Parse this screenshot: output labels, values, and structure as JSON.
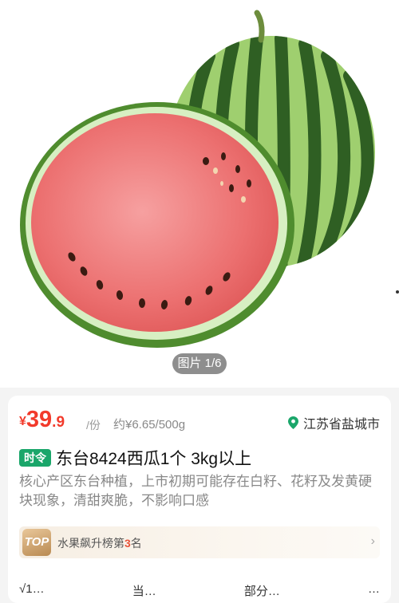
{
  "gallery": {
    "image_alt": "watermelon",
    "counter": "图片 1/6"
  },
  "product": {
    "price": {
      "currency": "¥",
      "integer": "39",
      "decimal": ".9",
      "unit": "/份"
    },
    "approx_price": "约¥6.65/500g",
    "location": "江苏省盐城市",
    "badge": "时令",
    "title": "东台8424西瓜1个 3kg以上",
    "description": "核心产区东台种植，上市初期可能存在白籽、花籽及发黄硬块现象，清甜爽脆，不影响口感",
    "ranking": {
      "badge": "TOP",
      "text_before": "水果飙升榜第",
      "number": "3",
      "text_after": "名"
    },
    "features": [
      "√1…",
      "当…",
      "部分…",
      "…"
    ]
  },
  "colors": {
    "price": "#f23a2b",
    "badge": "#1aa66a",
    "rank_accent": "#e8533a"
  }
}
